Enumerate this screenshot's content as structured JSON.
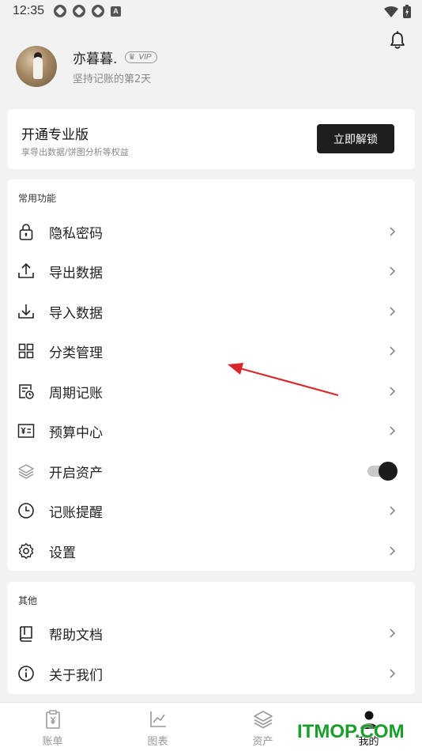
{
  "status_bar": {
    "time": "12:35",
    "notif_icons": [
      "app-icon",
      "app-icon",
      "app-icon",
      "a-icon"
    ],
    "a_icon_text": "A"
  },
  "profile": {
    "name": "亦暮暮.",
    "vip_badge": "VIP",
    "subtitle": "坚持记账的第2天"
  },
  "pro_card": {
    "title": "开通专业版",
    "description": "享导出数据/饼图分析等权益",
    "button_label": "立即解锁"
  },
  "common_functions": {
    "section_title": "常用功能",
    "items": [
      {
        "label": "隐私密码",
        "icon": "lock-icon"
      },
      {
        "label": "导出数据",
        "icon": "upload-icon"
      },
      {
        "label": "导入数据",
        "icon": "download-icon"
      },
      {
        "label": "分类管理",
        "icon": "grid-icon"
      },
      {
        "label": "周期记账",
        "icon": "calendar-clock-icon"
      },
      {
        "label": "预算中心",
        "icon": "budget-icon"
      },
      {
        "label": "开启资产",
        "icon": "layers-icon",
        "toggle": true,
        "toggle_on": true
      },
      {
        "label": "记账提醒",
        "icon": "clock-icon"
      },
      {
        "label": "设置",
        "icon": "gear-icon"
      }
    ]
  },
  "other": {
    "section_title": "其他",
    "items": [
      {
        "label": "帮助文档",
        "icon": "book-icon"
      },
      {
        "label": "关于我们",
        "icon": "info-icon"
      }
    ]
  },
  "tab_bar": {
    "tabs": [
      {
        "label": "账单",
        "icon": "bill-icon",
        "active": false
      },
      {
        "label": "图表",
        "icon": "chart-icon",
        "active": false
      },
      {
        "label": "资产",
        "icon": "layers-icon",
        "active": false
      },
      {
        "label": "我的",
        "icon": "person-icon",
        "active": true
      }
    ]
  },
  "annotation": {
    "arrow_color": "#d9262b"
  },
  "watermark": "ITMOP.COM",
  "colors": {
    "accent_dark": "#1e1e1e",
    "background": "#f2f2f2",
    "watermark_green": "#1a9e2b"
  }
}
